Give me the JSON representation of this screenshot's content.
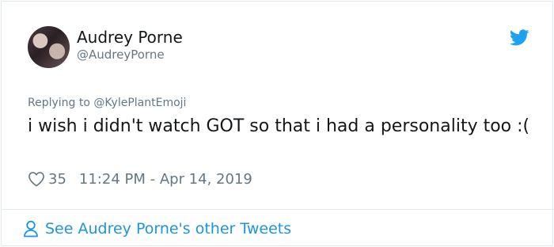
{
  "tweet": {
    "author_name": "Audrey Porne",
    "author_handle": "@AudreyPorne",
    "replying_to": "Replying to @KylePlantEmoji",
    "text": "i wish i didn't watch GOT so that i had a personality too :(",
    "like_count": "35",
    "timestamp": "11:24 PM - Apr 14, 2019"
  },
  "footer": {
    "see_more_label": "See Audrey Porne's other Tweets"
  },
  "icons": {
    "brand": "twitter-bird-icon",
    "like": "heart-outline-icon",
    "profile": "person-outline-icon"
  },
  "colors": {
    "brand": "#1da1f2",
    "link": "#1b95e0",
    "secondary_text": "#657786",
    "border": "#e1e8ed"
  }
}
